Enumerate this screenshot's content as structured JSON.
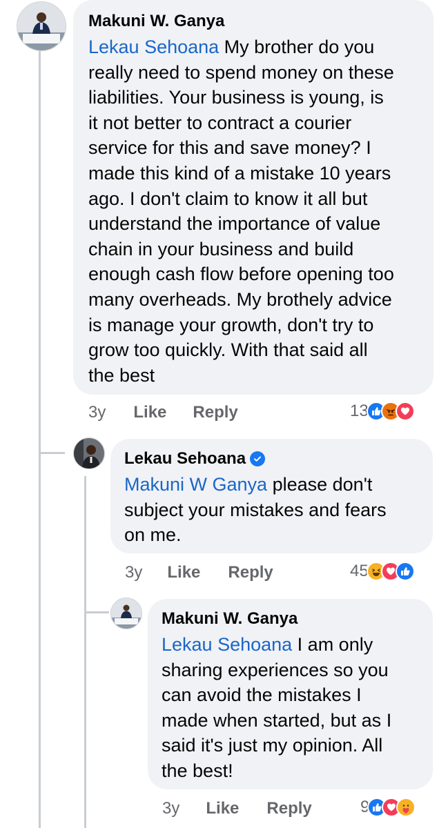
{
  "comments": [
    {
      "author": "Makuni W. Ganya",
      "mention": "Lekau Sehoana",
      "lines": [
        " My brother do you",
        "really need to spend money on these",
        "liabilities. Your business is young, is",
        "it not better to contract a courier",
        "service for this and save money? I",
        "made this kind of a mistake 10 years",
        "ago. I don't claim to know it all but",
        "understand the importance of value",
        "chain in your business and build",
        "enough cash flow before opening too",
        "many overheads. My brothely advice",
        "is manage your growth, don't try to",
        "grow too quickly. With that said all",
        "the best"
      ],
      "time": "3y",
      "like_label": "Like",
      "reply_label": "Reply",
      "reaction_count": "13",
      "reactions": [
        "like",
        "angry",
        "love"
      ]
    },
    {
      "author": "Lekau Sehoana",
      "verified": true,
      "mention": "Makuni W Ganya",
      "lines": [
        " please don't",
        "subject your mistakes and fears",
        "on me."
      ],
      "time": "3y",
      "like_label": "Like",
      "reply_label": "Reply",
      "reaction_count": "45",
      "reactions": [
        "haha",
        "love",
        "like"
      ]
    },
    {
      "author": "Makuni W. Ganya",
      "mention": "Lekau Sehoana",
      "lines": [
        " I am only",
        "sharing experiences so you",
        "can avoid the mistakes I",
        "made when started, but as I",
        "said it's just my opinion. All",
        "the best!"
      ],
      "time": "3y",
      "like_label": "Like",
      "reply_label": "Reply",
      "reaction_count": "9",
      "reactions": [
        "like",
        "love",
        "care"
      ]
    }
  ],
  "colors": {
    "bubble": "#f0f2f5",
    "mention": "#1a66c9",
    "meta": "#65676b",
    "like": "#1877f2",
    "love": "#f33e58",
    "angry": "#e9710f",
    "haha": "#f7b125"
  },
  "icons": {
    "like": "thumbs-up-icon",
    "love": "heart-icon",
    "angry": "angry-face-icon",
    "haha": "laughing-face-icon",
    "care": "care-face-icon",
    "verified": "verified-badge-icon"
  }
}
